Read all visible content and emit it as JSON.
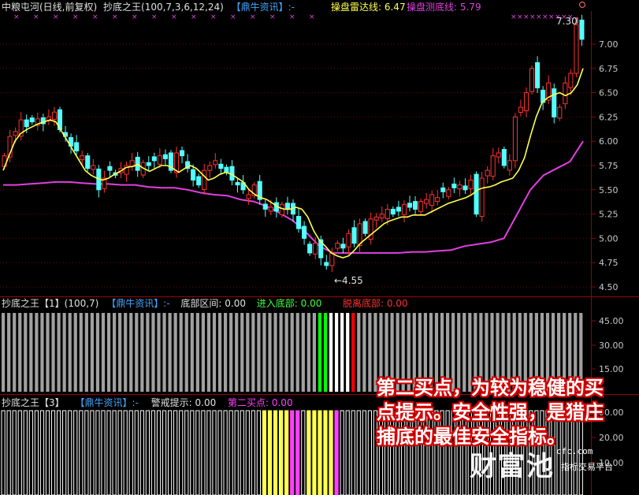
{
  "header": {
    "stock": "中粮屯河(日线,前复权)",
    "indicator": "抄底之王(100,7,3,6,12,24)",
    "source": "【鼎牛资讯】:-",
    "radar_label": "操盘雷达线: 6.47",
    "bottom_label": "操盘测底线: 5.79"
  },
  "main_panel": {
    "y_ticks": [
      "7.00",
      "6.75",
      "6.50",
      "6.25",
      "6.00",
      "5.75",
      "5.50",
      "5.25",
      "5.00",
      "4.75",
      "4.50"
    ],
    "high_marker": "7.30",
    "low_marker": "←4.55"
  },
  "panel1": {
    "title": "抄底之王【1】(100,7)",
    "source": "【鼎牛资讯】:-",
    "zone_label": "底部区间: 0.00",
    "enter_label": "进入底部: 0.00",
    "leave_label": "脱离底部: 0.00",
    "y_ticks": [
      "45.00",
      "30.00",
      "15.00"
    ]
  },
  "panel2": {
    "title": "抄底之王【3】",
    "source": "【鼎牛资讯】:-",
    "warn_label": "警戒提示: 0.00",
    "buy2_label": "第二买点: 0.00",
    "y_ticks": [
      "30.00",
      "20.00",
      "10.00"
    ]
  },
  "overlay_text": "第二买点，为较为稳健的买点提示。安全性强，是猎庄捕底的最佳安全指标。",
  "watermark": {
    "brand": "财富池",
    "site": "cfc.com",
    "tagline": "指标交易平台"
  },
  "colors": {
    "up": "#ff3232",
    "down": "#54ffff",
    "radar": "#ffff50",
    "bottom": "#e040e0",
    "grid": "#7a0000",
    "volume": "#a0a0a0",
    "enter": "#00ff00",
    "leave": "#ff0000",
    "warn": "#ffff50",
    "buy2": "#ff40ff"
  },
  "chart_data": {
    "type": "candlestick",
    "ylim": [
      4.5,
      7.3
    ],
    "closes": [
      5.85,
      6.05,
      6.1,
      6.22,
      6.15,
      6.2,
      6.23,
      6.18,
      6.25,
      6.3,
      6.12,
      6.05,
      5.95,
      5.9,
      5.85,
      5.72,
      5.75,
      5.5,
      5.62,
      5.7,
      5.65,
      5.72,
      5.75,
      5.8,
      5.7,
      5.78,
      5.75,
      5.8,
      5.85,
      5.82,
      5.7,
      5.88,
      5.85,
      5.72,
      5.6,
      5.55,
      5.7,
      5.75,
      5.8,
      5.72,
      5.68,
      5.6,
      5.55,
      5.5,
      5.45,
      5.55,
      5.4,
      5.3,
      5.32,
      5.28,
      5.35,
      5.3,
      5.25,
      5.1,
      5.0,
      4.85,
      4.95,
      4.8,
      4.72,
      4.85,
      4.95,
      4.9,
      5.05,
      4.95,
      5.15,
      5.05,
      5.2,
      5.22,
      5.25,
      5.3,
      5.25,
      5.28,
      5.35,
      5.32,
      5.3,
      5.38,
      5.4,
      5.45,
      5.42,
      5.48,
      5.5,
      5.52,
      5.55,
      5.5,
      5.6,
      5.25,
      5.62,
      5.7,
      5.85,
      5.88,
      5.75,
      5.8,
      6.25,
      6.35,
      6.5,
      6.75,
      6.55,
      6.4,
      6.6,
      6.25,
      6.35,
      6.6,
      6.7,
      7.2,
      7.05
    ],
    "radar_line": [
      5.7,
      5.85,
      6.0,
      6.08,
      6.12,
      6.15,
      6.18,
      6.2,
      6.22,
      6.2,
      6.1,
      6.0,
      5.9,
      5.8,
      5.7,
      5.65,
      5.62,
      5.6,
      5.62,
      5.66,
      5.69,
      5.73,
      5.74,
      5.76,
      5.72,
      5.69,
      5.72,
      5.75,
      5.75,
      5.72,
      5.68,
      5.72,
      5.75,
      5.72,
      5.66,
      5.6,
      5.62,
      5.66,
      5.68,
      5.66,
      5.62,
      5.58,
      5.5,
      5.45,
      5.42,
      5.4,
      5.36,
      5.32,
      5.3,
      5.3,
      5.32,
      5.3,
      5.22,
      5.08,
      4.98,
      4.92,
      4.85,
      4.82,
      4.8,
      4.82,
      4.88,
      4.95,
      5.0,
      5.05,
      5.1,
      5.15,
      5.18,
      5.2,
      5.22,
      5.22,
      5.24,
      5.24,
      5.24,
      5.27,
      5.3,
      5.33,
      5.36,
      5.38,
      5.4,
      5.42,
      5.45,
      5.5,
      5.52,
      5.53,
      5.55,
      5.58,
      5.6,
      5.62,
      5.7,
      5.83,
      6.05,
      6.25,
      6.4,
      6.45,
      6.48,
      6.5,
      6.47,
      6.5,
      6.58,
      6.75
    ],
    "bottom_line": [
      5.55,
      5.55,
      5.56,
      5.57,
      5.58,
      5.58,
      5.57,
      5.56,
      5.56,
      5.55,
      5.55,
      5.53,
      5.52,
      5.52,
      5.5,
      5.47,
      5.45,
      5.44,
      5.4,
      5.38,
      5.33,
      5.26,
      5.18,
      5.06,
      4.92,
      4.85,
      4.85,
      4.85,
      4.85,
      4.85,
      4.85,
      4.86,
      4.86,
      4.87,
      4.88,
      4.92,
      4.94,
      4.96,
      5.0,
      5.25,
      5.5,
      5.65,
      5.72,
      5.79,
      6.0
    ]
  }
}
